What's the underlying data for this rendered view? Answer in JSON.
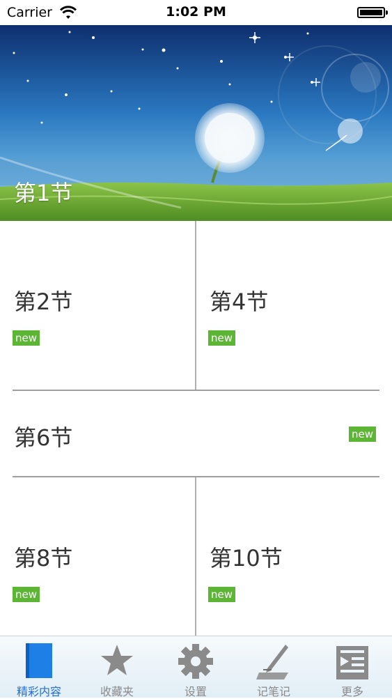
{
  "status_bar": {
    "carrier": "Carrier",
    "time": "1:02 PM",
    "icons": [
      "wifi-icon",
      "battery-icon"
    ]
  },
  "hero": {
    "title": "第1节",
    "image": "dandelion-meadow-banner"
  },
  "sections": [
    {
      "title": "第2节",
      "badge": "new"
    },
    {
      "title": "第4节",
      "badge": "new"
    },
    {
      "title": "第6节",
      "badge": "new"
    },
    {
      "title": "第8节",
      "badge": "new"
    },
    {
      "title": "第10节",
      "badge": "new"
    }
  ],
  "tab_bar": {
    "tabs": [
      {
        "label": "精彩内容",
        "icon": "book-icon",
        "active": true
      },
      {
        "label": "收藏夹",
        "icon": "star-icon",
        "active": false
      },
      {
        "label": "设置",
        "icon": "gear-icon",
        "active": false
      },
      {
        "label": "记笔记",
        "icon": "pen-icon",
        "active": false
      },
      {
        "label": "更多",
        "icon": "more-list-icon",
        "active": false
      }
    ]
  },
  "colors": {
    "badge": "#5cb534",
    "active_tab": "#1e6fd9",
    "inactive_tab": "#8a8a8a",
    "divider": "#b0b0b0"
  }
}
